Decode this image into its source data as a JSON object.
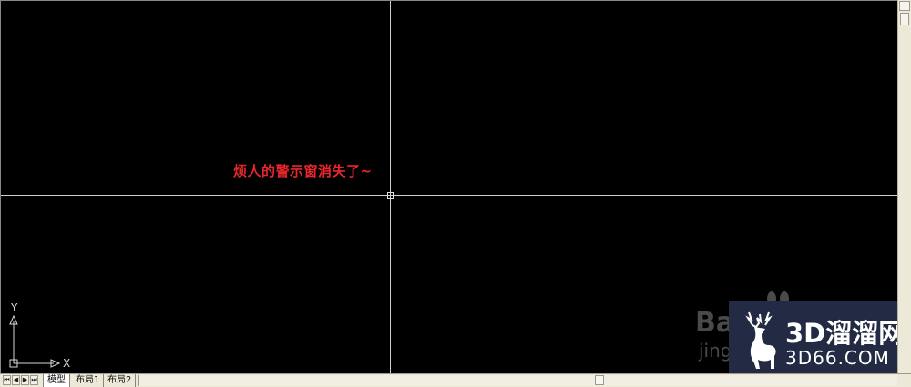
{
  "canvas": {
    "annotation": "烦人的警示窗消失了~",
    "ucs": {
      "x_label": "X",
      "y_label": "Y"
    },
    "crosshair_color": "#cfcfcf",
    "background": "#000000",
    "annotation_color": "#e8262e"
  },
  "watermark": {
    "baidu_text": "Ba",
    "baidu_sub": "jing",
    "brand_title": "3D溜溜网",
    "brand_domain": "3D66.COM",
    "brand_bg": "#232a43"
  },
  "tabs": [
    {
      "label": "模型",
      "active": true
    },
    {
      "label": "布局1",
      "active": false
    },
    {
      "label": "布局2",
      "active": false
    }
  ],
  "nav_buttons": [
    "first-icon",
    "prev-icon",
    "next-icon",
    "last-icon"
  ]
}
